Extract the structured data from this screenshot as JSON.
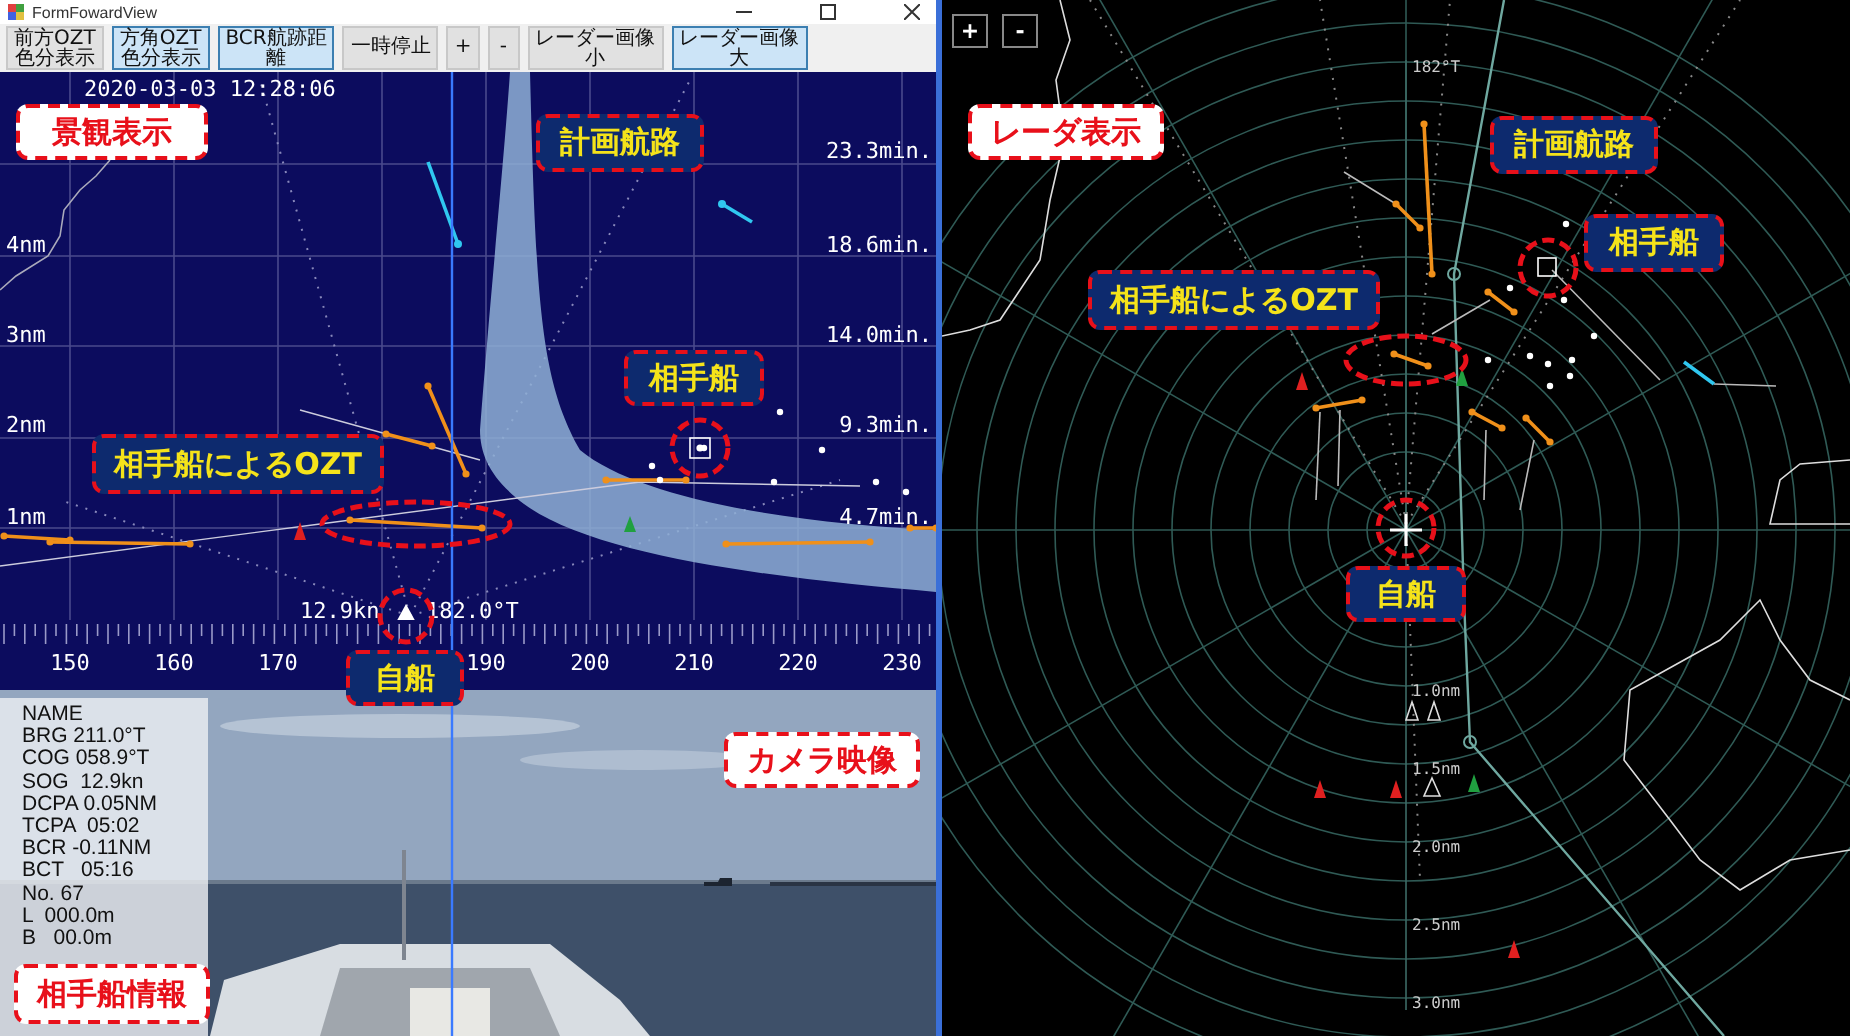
{
  "window": {
    "title": "FormFowardView"
  },
  "toolbar": {
    "buttons": [
      {
        "lines": [
          "前方OZT",
          "色分表示"
        ],
        "selected": false
      },
      {
        "lines": [
          "方角OZT",
          "色分表示"
        ],
        "selected": true
      },
      {
        "lines": [
          "BCR航跡距",
          "離"
        ],
        "selected": true
      },
      {
        "lines": [
          "一時停止"
        ],
        "selected": false
      },
      {
        "lines": [
          "+"
        ],
        "selected": false
      },
      {
        "lines": [
          "-"
        ],
        "selected": false
      },
      {
        "lines": [
          "レーダー画像",
          "小"
        ],
        "selected": false
      },
      {
        "lines": [
          "レーダー画像",
          "大"
        ],
        "selected": true
      }
    ]
  },
  "scenic_view": {
    "timestamp": "2020-03-03 12:28:06",
    "range_labels": [
      "4nm",
      "3nm",
      "2nm",
      "1nm"
    ],
    "time_labels": [
      "23.3min.",
      "18.6min.",
      "14.0min.",
      "9.3min.",
      "4.7min."
    ],
    "own_ship": {
      "speed": "12.9kn",
      "heading": "182.0°T"
    },
    "bearing_scale": [
      "150",
      "160",
      "170",
      "190",
      "200",
      "210",
      "220",
      "230"
    ],
    "annotations": [
      {
        "text": "景観表示",
        "kind": "panel"
      },
      {
        "text": "計画航路",
        "kind": "feature"
      },
      {
        "text": "相手船",
        "kind": "feature"
      },
      {
        "text": "相手船によるOZT",
        "kind": "feature"
      },
      {
        "text": "自船",
        "kind": "feature"
      }
    ]
  },
  "target_info": {
    "lines": [
      "NAME",
      "BRG 211.0°T",
      "COG 058.9°T",
      "SOG  12.9kn",
      "DCPA 0.05NM",
      "TCPA  05:02",
      "BCR -0.11NM",
      "BCT   05:16",
      "No. 67",
      "L  000.0m",
      "B   00.0m"
    ],
    "annotations": [
      {
        "text": "相手船情報",
        "kind": "panel"
      }
    ]
  },
  "camera": {
    "annotations": [
      {
        "text": "カメラ映像",
        "kind": "panel"
      }
    ]
  },
  "radar": {
    "zoom_buttons": [
      "+",
      "-"
    ],
    "heading": "182°T",
    "range_labels": [
      "1.0nm",
      "1.5nm",
      "2.0nm",
      "2.5nm",
      "3.0nm"
    ],
    "annotations": [
      {
        "text": "レーダ表示",
        "kind": "panel"
      },
      {
        "text": "計画航路",
        "kind": "feature"
      },
      {
        "text": "相手船",
        "kind": "feature"
      },
      {
        "text": "相手船によるOZT",
        "kind": "feature"
      },
      {
        "text": "自船",
        "kind": "feature"
      }
    ]
  }
}
